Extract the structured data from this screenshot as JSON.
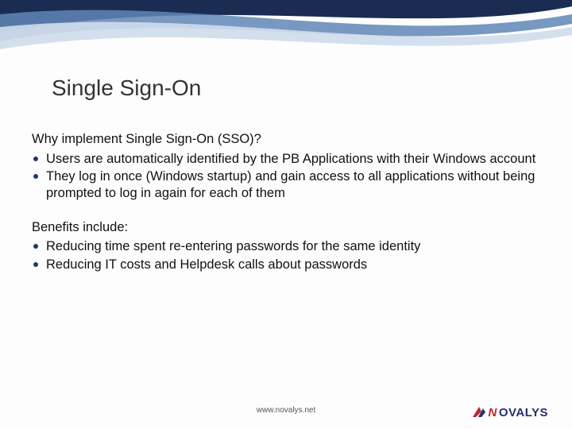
{
  "title": "Single Sign-On",
  "section1": {
    "lead": "Why implement Single Sign-On (SSO)?",
    "items": [
      "Users are automatically identified by the PB Applications with their Windows account",
      "They log in once (Windows startup) and gain access to all applications without being prompted to log in again for each of them"
    ]
  },
  "section2": {
    "lead": "Benefits include:",
    "items": [
      "Reducing time spent re-entering passwords for the same identity",
      "Reducing IT costs and Helpdesk calls about passwords"
    ]
  },
  "footer": "www.novalys.net",
  "logo": {
    "pre": "N",
    "post": "OVALYS"
  },
  "colors": {
    "accent_dark": "#1b2c52",
    "accent_mid": "#5f86b5",
    "accent_light": "#cfdceb",
    "logo_red": "#c1272d",
    "logo_navy": "#2a2f6e"
  }
}
